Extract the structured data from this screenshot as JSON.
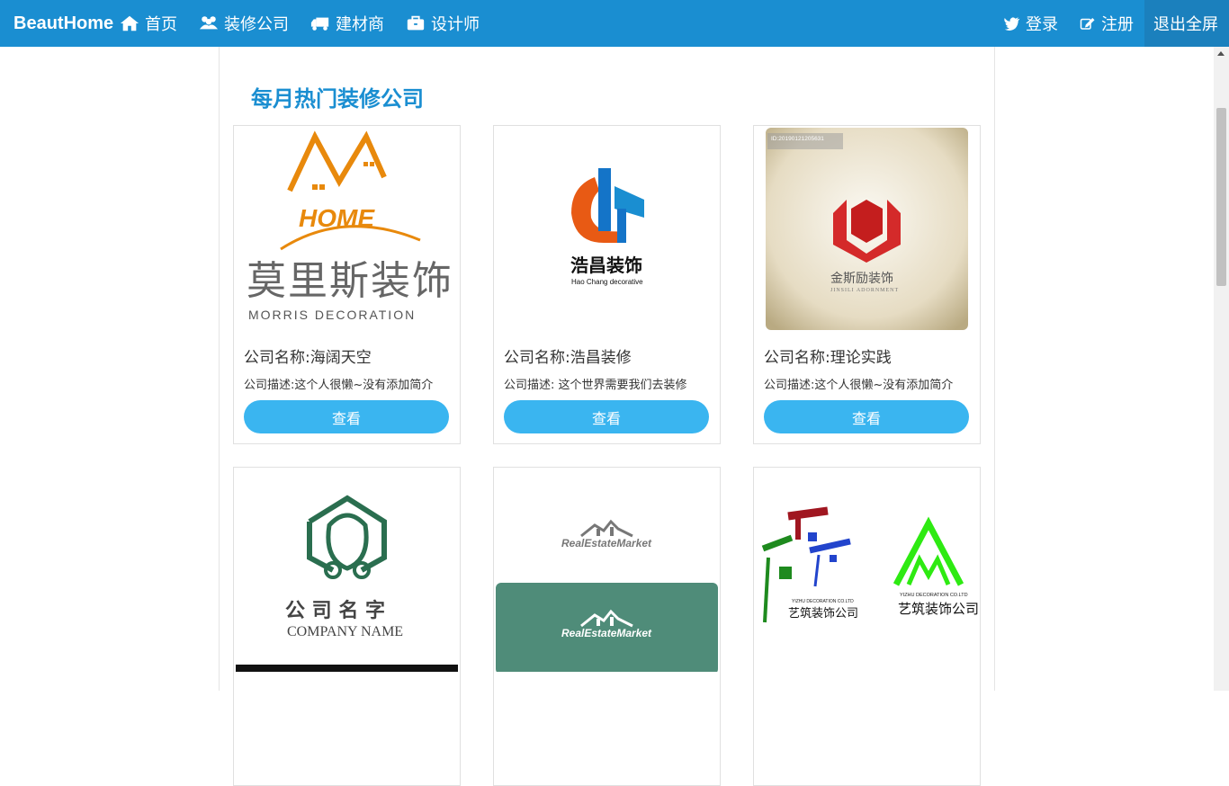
{
  "nav": {
    "brand": "BeautHome",
    "items": [
      {
        "label": "首页",
        "icon": "home-icon"
      },
      {
        "label": "装修公司",
        "icon": "users-icon"
      },
      {
        "label": "建材商",
        "icon": "truck-icon"
      },
      {
        "label": "设计师",
        "icon": "briefcase-icon"
      }
    ],
    "login": "登录",
    "register": "注册",
    "exit_fullscreen": "退出全屏"
  },
  "main": {
    "section_title": "每月热门装修公司",
    "cards": [
      {
        "name": "公司名称:海阔天空",
        "desc": "公司描述:这个人很懒~没有添加简介",
        "button": "查看",
        "logo": {
          "main": "莫里斯装饰",
          "sub": "MORRIS DECORATION",
          "mark": "HOME"
        }
      },
      {
        "name": "公司名称:浩昌装修",
        "desc": "公司描述: 这个世界需要我们去装修",
        "button": "查看",
        "logo": {
          "main": "浩昌装饰",
          "sub": "Hao Chang decorative"
        }
      },
      {
        "name": "公司名称:理论实践",
        "desc": "公司描述:这个人很懒~没有添加简介",
        "button": "查看",
        "logo": {
          "main": "金斯励装饰",
          "sub": "JINSILI ADORNMENT",
          "watermark": "ID:20190121205631"
        }
      },
      {
        "name": "",
        "desc": "",
        "button": "",
        "logo": {
          "main": "公 司 名 字",
          "sub": "COMPANY NAME"
        }
      },
      {
        "name": "",
        "desc": "",
        "button": "",
        "logo": {
          "main": "RealEstateMarket",
          "sub": "RealEstateMarket"
        }
      },
      {
        "name": "",
        "desc": "",
        "button": "",
        "logo": {
          "main": "艺筑装饰公司",
          "sub": "YIZHU DECORATION CO.LTD",
          "main2": "艺筑装饰公司",
          "sub2": "YIZHU DECORATION CO.LTD"
        }
      }
    ]
  },
  "colors": {
    "navbar": "#1a8ed1",
    "accent": "#3ab5f0",
    "title": "#1a8ed1"
  }
}
